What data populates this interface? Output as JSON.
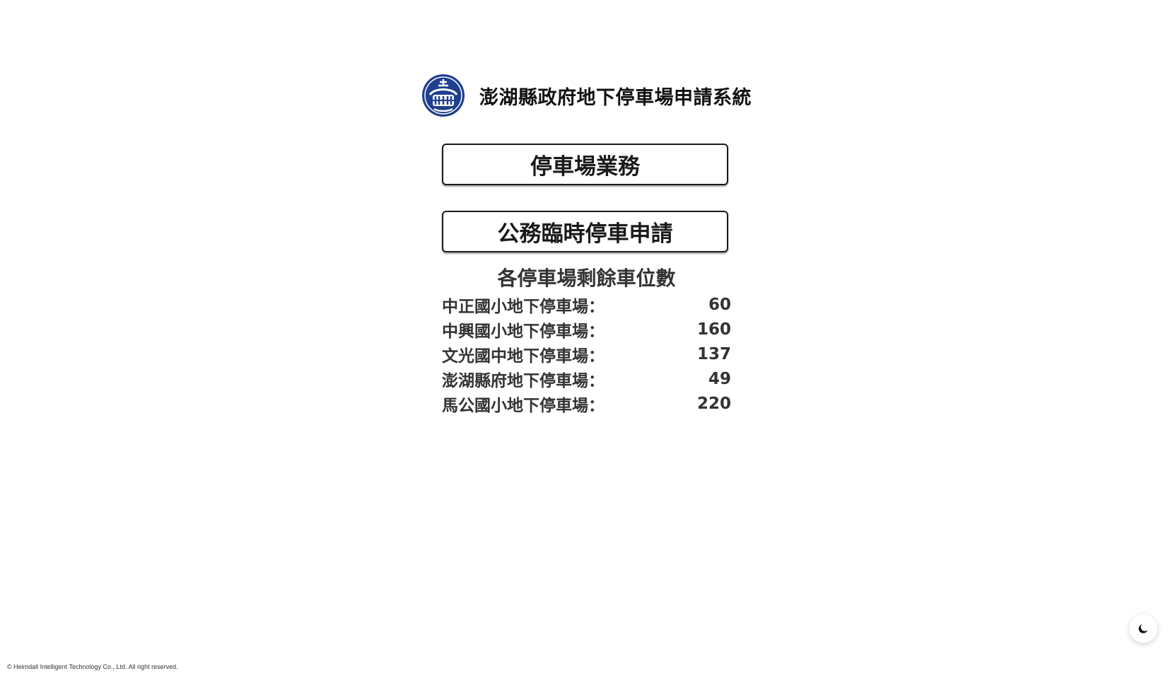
{
  "header": {
    "title": "澎湖縣政府地下停車場申請系統",
    "logo_icon": "county-seal-logo",
    "logo_color": "#1f3f8f"
  },
  "menu": {
    "parking_business_label": "停車場業務",
    "official_temp_parking_label": "公務臨時停車申請"
  },
  "availability": {
    "title": "各停車場剩餘車位數",
    "lots": [
      {
        "name": "中正國小地下停車場：",
        "count": "60"
      },
      {
        "name": "中興國小地下停車場：",
        "count": "160"
      },
      {
        "name": "文光國中地下停車場：",
        "count": "137"
      },
      {
        "name": "澎湖縣府地下停車場：",
        "count": "49"
      },
      {
        "name": "馬公國小地下停車場：",
        "count": "220"
      }
    ]
  },
  "footer": {
    "copyright": "© Heimdall Intelligent Technology Co., Ltd. All right reserved."
  },
  "theme_toggle": {
    "icon": "moon-icon"
  }
}
